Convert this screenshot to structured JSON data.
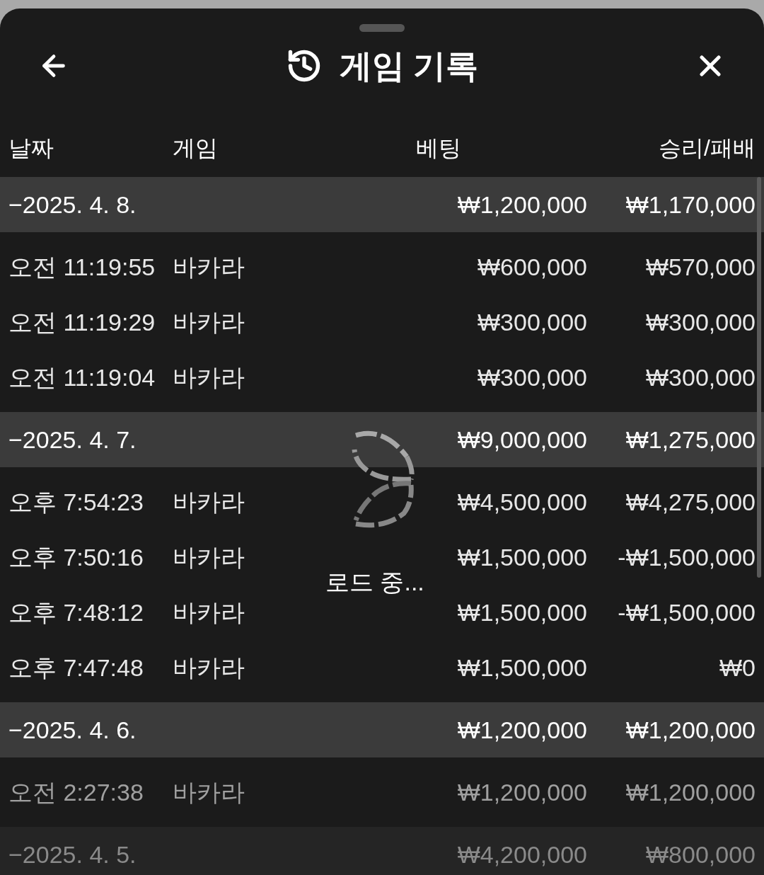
{
  "header": {
    "title": "게임 기록"
  },
  "columns": [
    "날짜",
    "게임",
    "베팅",
    "승리/패배"
  ],
  "groups": [
    {
      "date": "−2025. 4. 8.",
      "bet": "₩1,200,000",
      "result": "₩1,170,000",
      "rows": [
        {
          "time": "오전 11:19:55",
          "game": "바카라",
          "bet": "₩600,000",
          "result": "₩570,000"
        },
        {
          "time": "오전 11:19:29",
          "game": "바카라",
          "bet": "₩300,000",
          "result": "₩300,000"
        },
        {
          "time": "오전 11:19:04",
          "game": "바카라",
          "bet": "₩300,000",
          "result": "₩300,000"
        }
      ]
    },
    {
      "date": "−2025. 4. 7.",
      "bet": "₩9,000,000",
      "result": "₩1,275,000",
      "rows": [
        {
          "time": "오후 7:54:23",
          "game": "바카라",
          "bet": "₩4,500,000",
          "result": "₩4,275,000"
        },
        {
          "time": "오후 7:50:16",
          "game": "바카라",
          "bet": "₩1,500,000",
          "result": "-₩1,500,000"
        },
        {
          "time": "오후 7:48:12",
          "game": "바카라",
          "bet": "₩1,500,000",
          "result": "-₩1,500,000"
        },
        {
          "time": "오후 7:47:48",
          "game": "바카라",
          "bet": "₩1,500,000",
          "result": "₩0"
        }
      ]
    },
    {
      "date": "−2025. 4. 6.",
      "bet": "₩1,200,000",
      "result": "₩1,200,000",
      "rows": [
        {
          "time": "오전 2:27:38",
          "game": "바카라",
          "bet": "₩1,200,000",
          "result": "₩1,200,000",
          "faded": true
        }
      ]
    },
    {
      "date": "−2025. 4. 5.",
      "bet": "₩4,200,000",
      "result": "₩800,000",
      "faded": true
    }
  ],
  "loading": {
    "label": "로드 중..."
  }
}
